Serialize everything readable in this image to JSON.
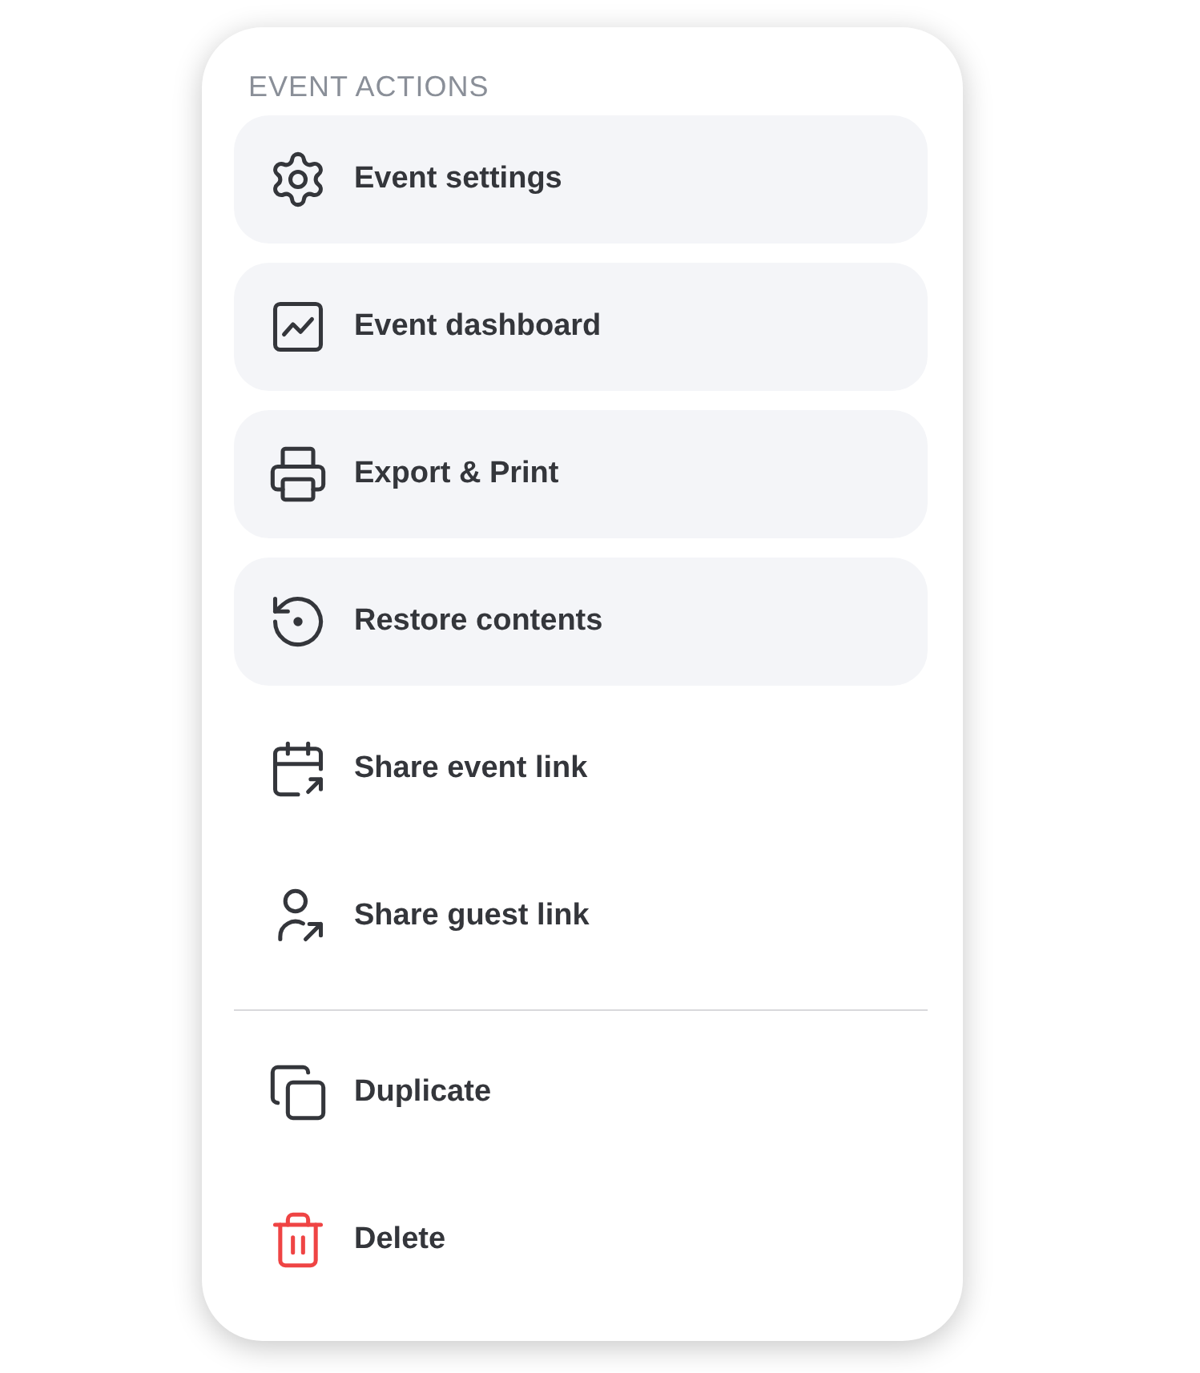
{
  "menu": {
    "heading": "EVENT ACTIONS",
    "groups": [
      {
        "items": [
          {
            "label": "Event settings",
            "kind": "tile"
          },
          {
            "label": "Event dashboard",
            "kind": "tile"
          },
          {
            "label": "Export & Print",
            "kind": "tile"
          },
          {
            "label": "Restore contents",
            "kind": "tile"
          },
          {
            "label": "Share event link",
            "kind": "plain"
          },
          {
            "label": "Share guest link",
            "kind": "plain"
          }
        ]
      },
      {
        "items": [
          {
            "label": "Duplicate",
            "kind": "plain"
          },
          {
            "label": "Delete",
            "kind": "danger"
          }
        ]
      }
    ]
  }
}
